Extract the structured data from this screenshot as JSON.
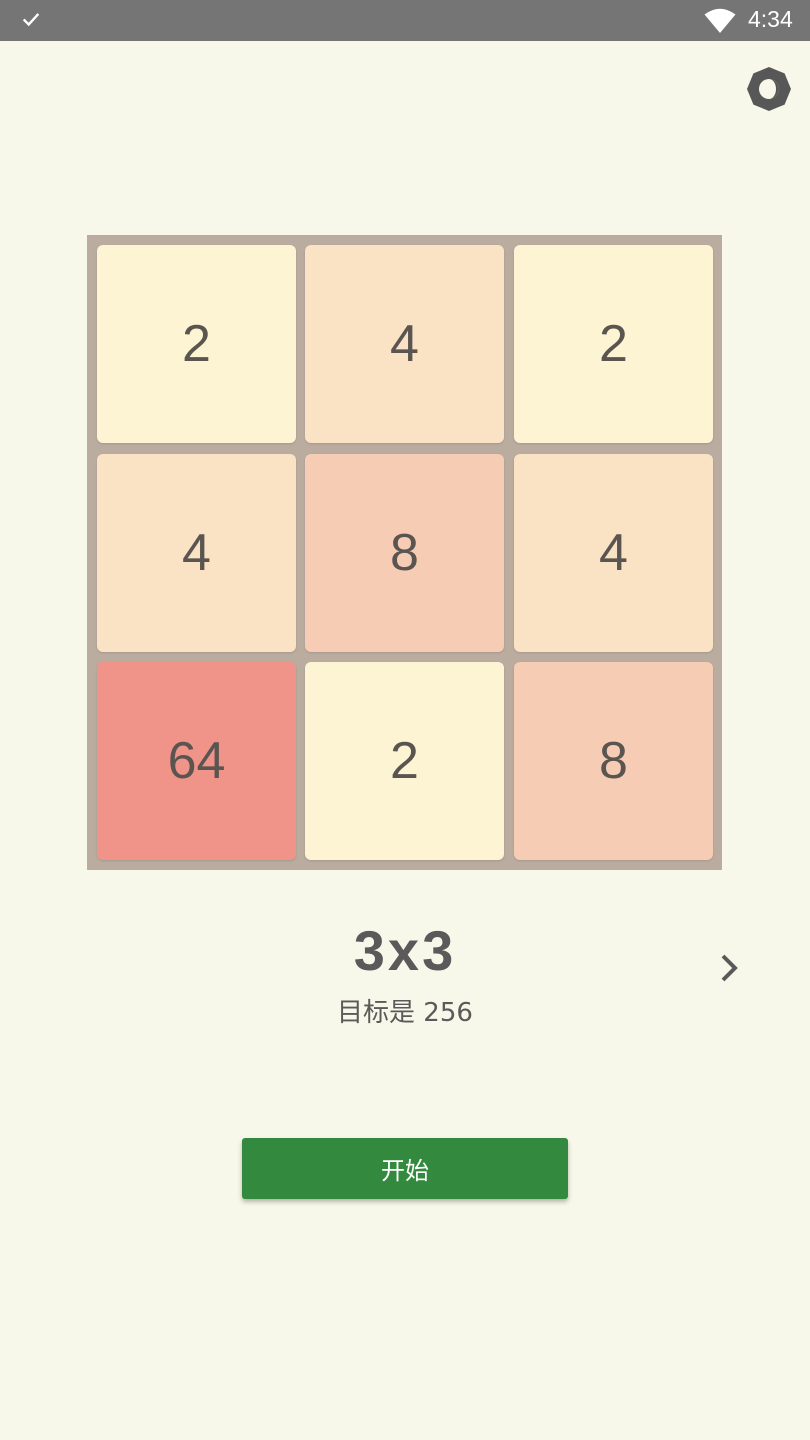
{
  "status_bar": {
    "time": "4:34",
    "check_icon": "check-icon",
    "wifi_icon": "wifi-icon"
  },
  "theme_toggle": {
    "icon": "brightness-icon"
  },
  "board": {
    "tiles": [
      {
        "value": "2",
        "color": "#fcf4d2"
      },
      {
        "value": "4",
        "color": "#fae2c5"
      },
      {
        "value": "2",
        "color": "#fcf4d2"
      },
      {
        "value": "4",
        "color": "#fae2c5"
      },
      {
        "value": "8",
        "color": "#f7ccb4"
      },
      {
        "value": "4",
        "color": "#fae2c5"
      },
      {
        "value": "64",
        "color": "#f0948a"
      },
      {
        "value": "2",
        "color": "#fcf4d2"
      },
      {
        "value": "8",
        "color": "#f7ccb4"
      }
    ]
  },
  "mode": {
    "label": "3x3",
    "goal": "目标是 256",
    "next_icon": "chevron-right-icon"
  },
  "start_button": {
    "label": "开始"
  },
  "colors": {
    "background": "#f8f8ea",
    "board": "#bbaca0",
    "accent": "#338a3e",
    "status_bar": "#757575"
  }
}
